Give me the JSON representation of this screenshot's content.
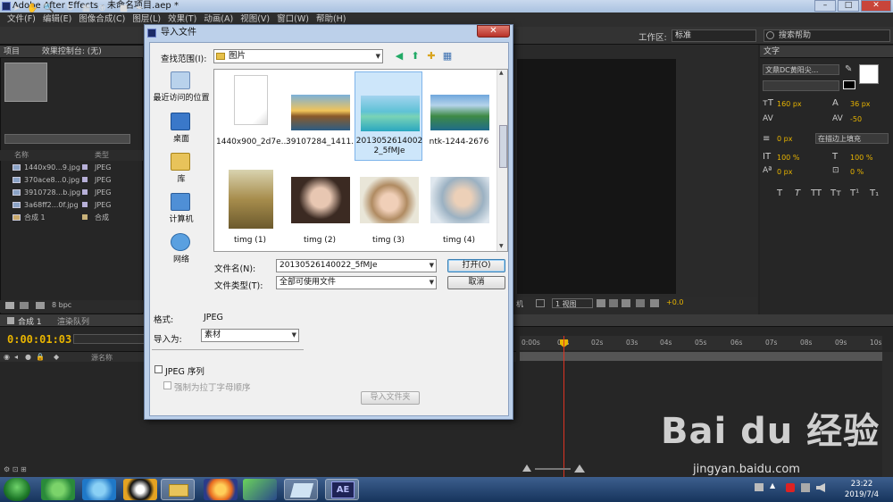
{
  "window": {
    "title": "Adobe After Effects - 未命名项目.aep *",
    "min": "–",
    "max": "□",
    "close": "✕"
  },
  "menu": [
    "文件(F)",
    "编辑(E)",
    "图像合成(C)",
    "图层(L)",
    "效果(T)",
    "动画(A)",
    "视图(V)",
    "窗口(W)",
    "帮助(H)"
  ],
  "toolbar": {
    "workspace_label": "工作区:",
    "workspace_value": "标准",
    "search_help": "搜索帮助"
  },
  "project_panel": {
    "tab": "项目",
    "effect_controls_tab": "效果控制台: (无)",
    "col_name": "名称",
    "col_type": "类型",
    "items": [
      {
        "name": "1440x90...9.jpg",
        "type": "JPEG"
      },
      {
        "name": "370ace8...0.jpg",
        "type": "JPEG"
      },
      {
        "name": "3910728...b.jpg",
        "type": "JPEG"
      },
      {
        "name": "3a68ff2...0f.jpg",
        "type": "JPEG"
      },
      {
        "name": "合成 1",
        "type": "合成"
      }
    ],
    "bpc": "8 bpc"
  },
  "viewer": {
    "view_mode": "1 视图",
    "plus": "+0.0",
    "cam": "机"
  },
  "char_panel": {
    "tab": "文字",
    "font": "文鼎DC黄阳尖...",
    "size": "160 px",
    "leading": "36 px",
    "tracking": "-50",
    "indent": "0 px",
    "stroke_option": "在描边上填充",
    "vscale": "100 %",
    "hscale": "100 %",
    "baseline": "0 px",
    "tsume": "0 %",
    "styles": [
      "T",
      "T",
      "TT",
      "Tт",
      "T¹",
      "T₁"
    ]
  },
  "timeline": {
    "tab_comp": "合成 1",
    "tab_render": "渲染队列",
    "timecode": "0:00:01:03",
    "col_source": "源名称",
    "ruler": [
      "0:00s",
      "01s",
      "02s",
      "03s",
      "04s",
      "05s",
      "06s",
      "07s",
      "08s",
      "09s",
      "10s"
    ]
  },
  "dialog": {
    "title": "导入文件",
    "close": "✕",
    "look_in_label": "查找范围(I):",
    "look_in_value": "图片",
    "places": [
      "最近访问的位置",
      "桌面",
      "库",
      "计算机",
      "网络"
    ],
    "files": [
      {
        "name": "1440x900_2d7e...",
        "kind": "doc"
      },
      {
        "name": "39107284_1411...",
        "kind": "sunset"
      },
      {
        "name": "20130526140022_5fMJe",
        "kind": "island"
      },
      {
        "name": "ntk-1244-2676",
        "kind": "coast"
      },
      {
        "name": "timg (1)",
        "kind": "girl1"
      },
      {
        "name": "timg (2)",
        "kind": "girl2"
      },
      {
        "name": "timg (3)",
        "kind": "girl3"
      },
      {
        "name": "timg (4)",
        "kind": "girl4"
      }
    ],
    "filename_label": "文件名(N):",
    "filename_value": "20130526140022_5fMJe",
    "filetype_label": "文件类型(T):",
    "filetype_value": "全部可使用文件",
    "open_btn": "打开(O)",
    "cancel_btn": "取消",
    "format_label": "格式:",
    "format_value": "JPEG",
    "import_as_label": "导入为:",
    "import_as_value": "素材",
    "jpeg_sequence": "JPEG 序列",
    "force_alpha": "强制为拉丁字母顺序",
    "import_folder_btn": "导入文件夹"
  },
  "taskbar": {
    "time": "23:22",
    "date": "2019/7/4",
    "ae_label": "AE"
  },
  "watermark": {
    "brand": "Bai du 经验",
    "url": "jingyan.baidu.com"
  }
}
